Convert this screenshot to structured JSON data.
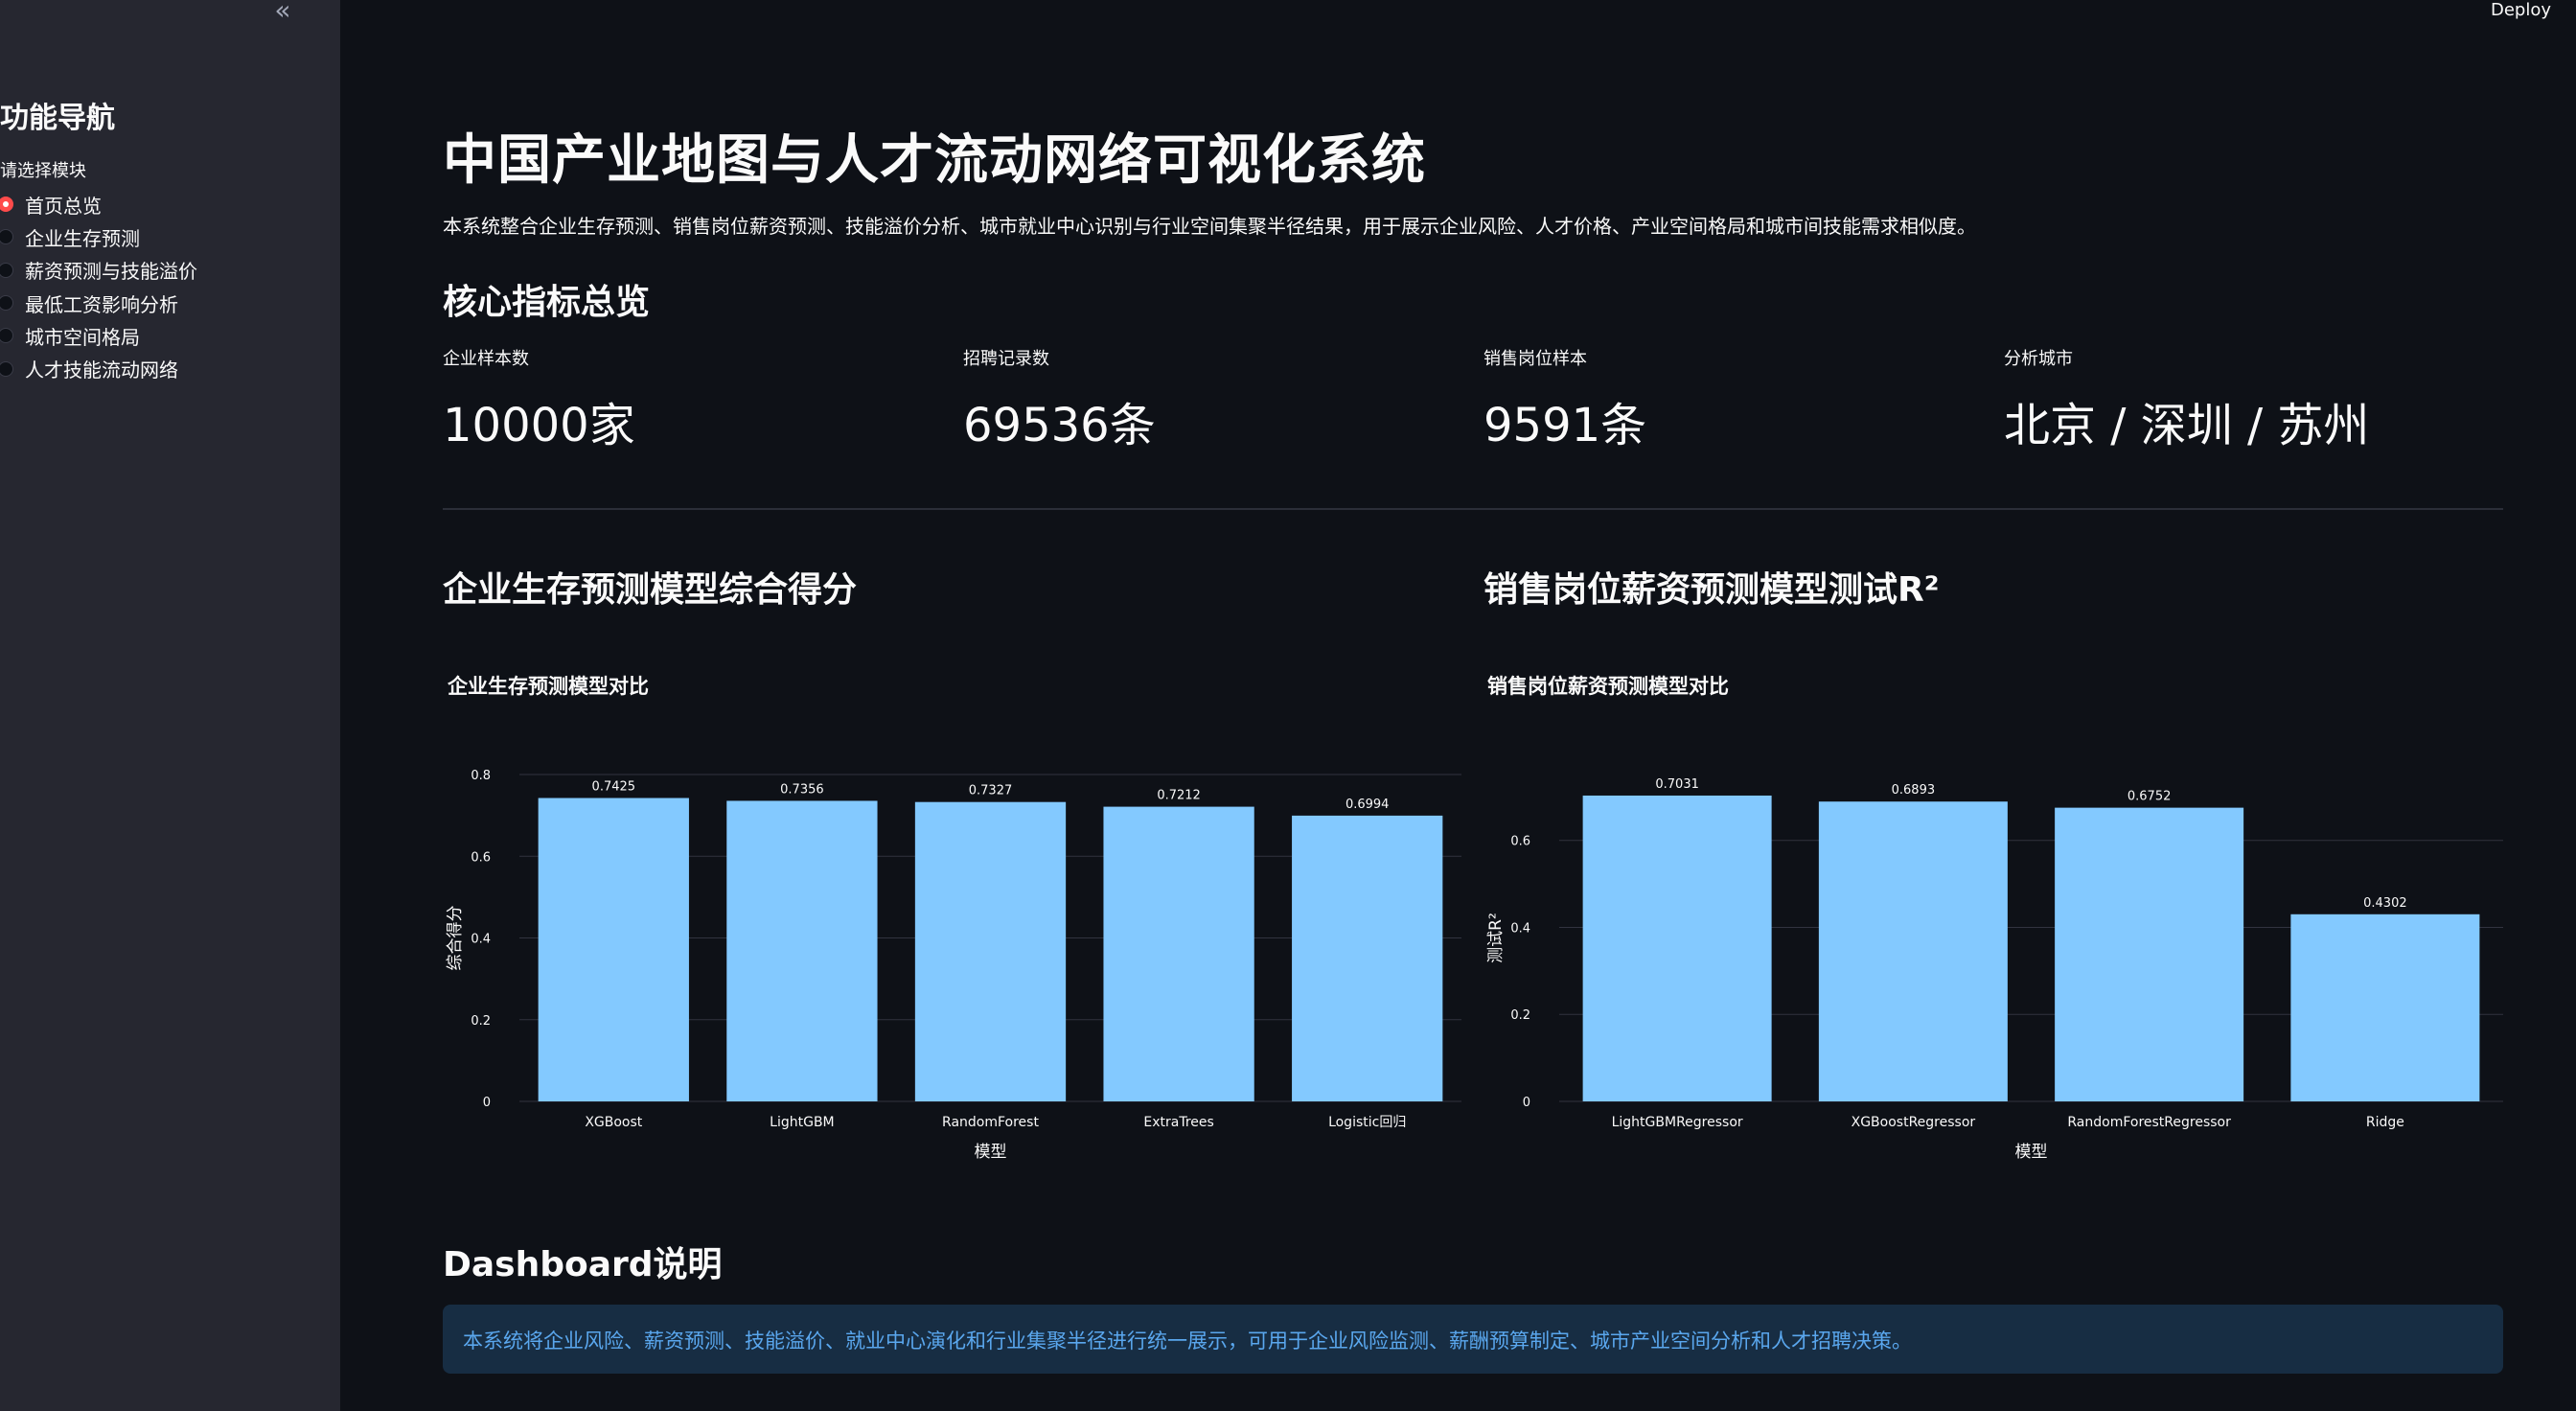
{
  "sidebar": {
    "collapse_icon": "«",
    "title": "功能导航",
    "select_label": "请选择模块",
    "items": [
      {
        "label": "首页总览",
        "selected": true
      },
      {
        "label": "企业生存预测",
        "selected": false
      },
      {
        "label": "薪资预测与技能溢价",
        "selected": false
      },
      {
        "label": "最低工资影响分析",
        "selected": false
      },
      {
        "label": "城市空间格局",
        "selected": false
      },
      {
        "label": "人才技能流动网络",
        "selected": false
      }
    ]
  },
  "header": {
    "deploy_label": "Deploy"
  },
  "main": {
    "title": "中国产业地图与人才流动网络可视化系统",
    "description": "本系统整合企业生存预测、销售岗位薪资预测、技能溢价分析、城市就业中心识别与行业空间集聚半径结果，用于展示企业风险、人才价格、产业空间格局和城市间技能需求相似度。",
    "metrics_heading": "核心指标总览",
    "metrics": [
      {
        "label": "企业样本数",
        "value": "10000家"
      },
      {
        "label": "招聘记录数",
        "value": "69536条"
      },
      {
        "label": "销售岗位样本",
        "value": "9591条"
      },
      {
        "label": "分析城市",
        "value": "北京 / 深圳 / 苏州"
      }
    ],
    "left_chart_heading": "企业生存预测模型综合得分",
    "right_chart_heading": "销售岗位薪资预测模型测试R²",
    "dashboard_heading": "Dashboard说明",
    "info_text": "本系统将企业风险、薪资预测、技能溢价、就业中心演化和行业集聚半径进行统一展示，可用于企业风险监测、薪酬预算制定、城市产业空间分析和人才招聘决策。"
  },
  "colors": {
    "bar": "#83c9ff",
    "accent": "#ff4b4b",
    "info_bg": "#172d43",
    "info_text": "#5aa7ee"
  },
  "chart_data": [
    {
      "type": "bar",
      "title": "企业生存预测模型对比",
      "xlabel": "模型",
      "ylabel": "综合得分",
      "categories": [
        "XGBoost",
        "LightGBM",
        "RandomForest",
        "ExtraTrees",
        "Logistic回归"
      ],
      "values": [
        0.7425,
        0.7356,
        0.7327,
        0.7212,
        0.6994
      ],
      "value_labels": [
        "0.7425",
        "0.7356",
        "0.7327",
        "0.7212",
        "0.6994"
      ],
      "yticks": [
        0,
        0.2,
        0.4,
        0.6,
        0.8
      ],
      "ytick_labels": [
        "0",
        "0.2",
        "0.4",
        "0.6",
        "0.8"
      ],
      "ylim": [
        0,
        0.8
      ],
      "grid": true
    },
    {
      "type": "bar",
      "title": "销售岗位薪资预测模型对比",
      "xlabel": "模型",
      "ylabel": "测试R²",
      "categories": [
        "LightGBMRegressor",
        "XGBoostRegressor",
        "RandomForestRegressor",
        "Ridge"
      ],
      "values": [
        0.7031,
        0.6893,
        0.6752,
        0.4302
      ],
      "value_labels": [
        "0.7031",
        "0.6893",
        "0.6752",
        "0.4302"
      ],
      "yticks": [
        0,
        0.2,
        0.4,
        0.6
      ],
      "ytick_labels": [
        "0",
        "0.2",
        "0.4",
        "0.6"
      ],
      "ylim": [
        0,
        0.7515
      ],
      "grid": true
    }
  ]
}
